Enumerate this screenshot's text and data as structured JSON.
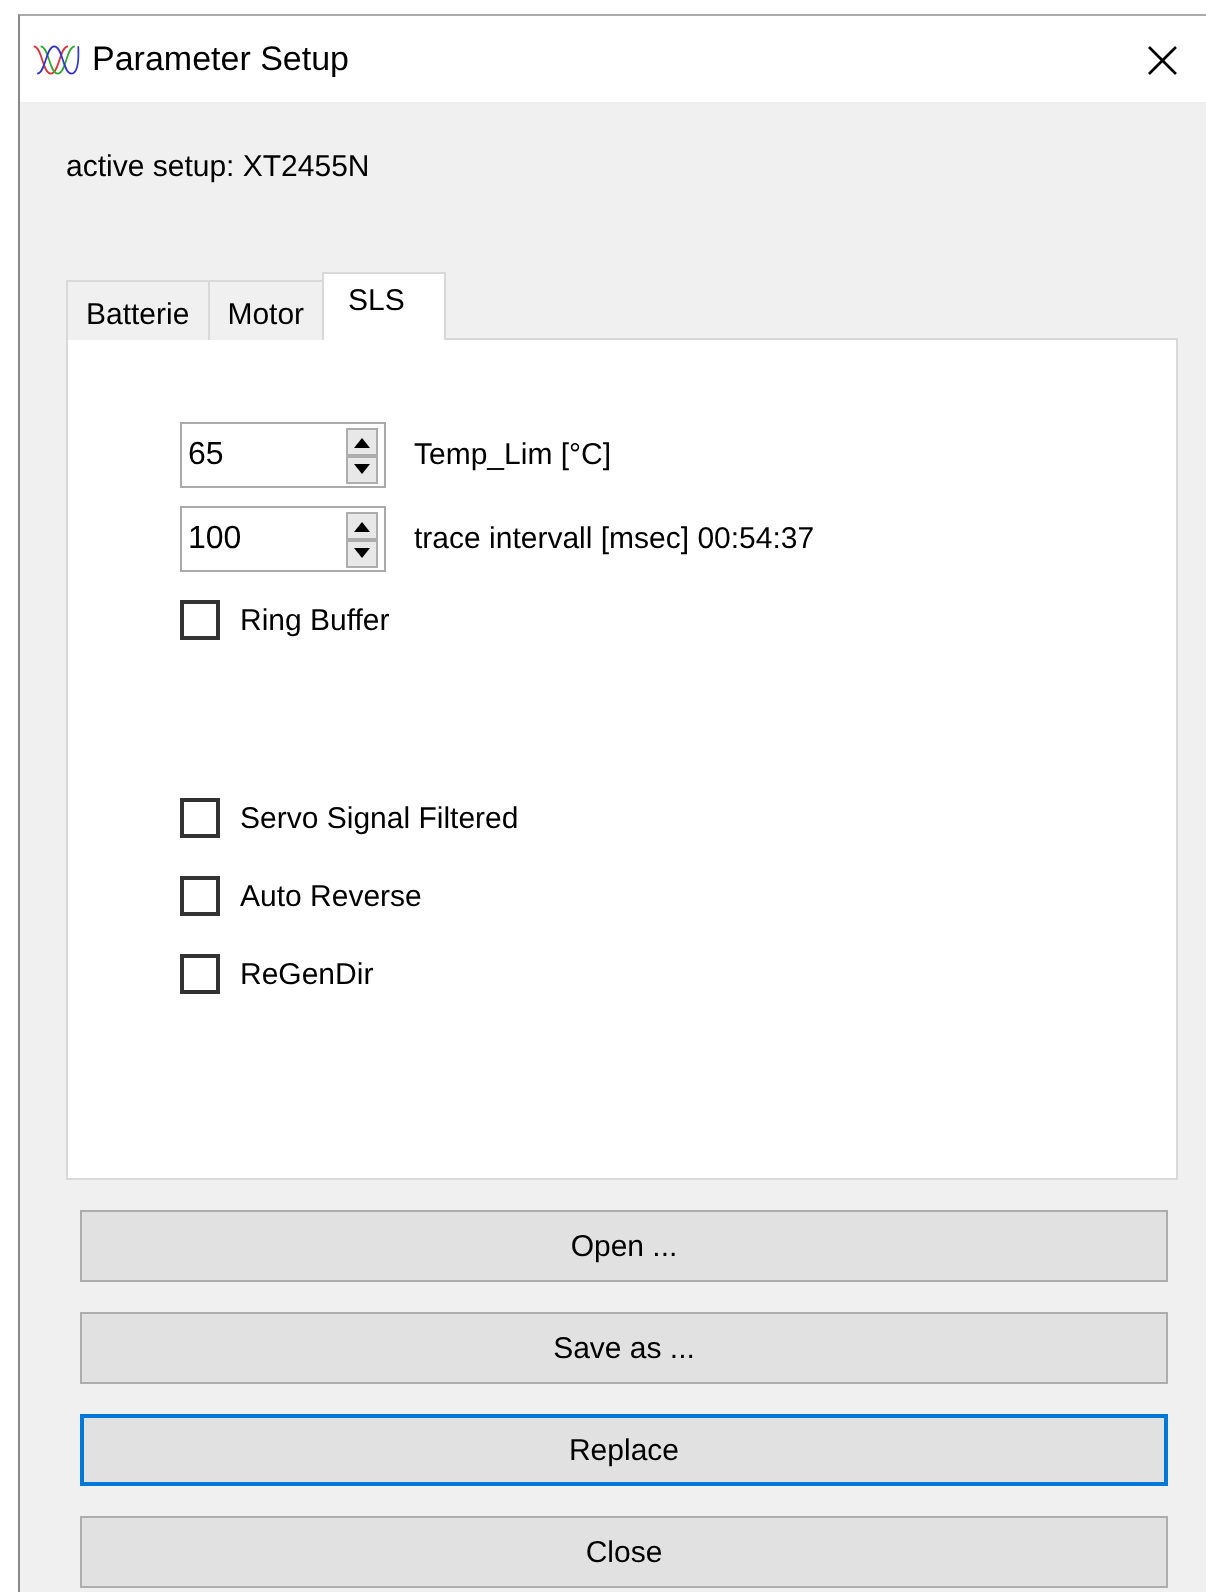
{
  "window": {
    "title": "Parameter Setup",
    "close": "×"
  },
  "active_setup": "active setup: XT2455N",
  "tabs": [
    {
      "label": "Batterie",
      "selected": false
    },
    {
      "label": "Motor",
      "selected": false
    },
    {
      "label": "SLS",
      "selected": true
    }
  ],
  "spinners": [
    {
      "value": "65",
      "label": "Temp_Lim [°C]"
    },
    {
      "value": "100",
      "label": "trace intervall [msec] 00:54:37"
    }
  ],
  "checkbox_groups": [
    [
      {
        "label": "Ring Buffer",
        "checked": false
      }
    ],
    [
      {
        "label": "Servo Signal Filtered",
        "checked": false
      },
      {
        "label": "Auto Reverse",
        "checked": false
      },
      {
        "label": "ReGenDir",
        "checked": false
      }
    ]
  ],
  "buttons": [
    {
      "label": "Open ...",
      "focused": false
    },
    {
      "label": "Save as ...",
      "focused": false
    },
    {
      "label": "Replace",
      "focused": true
    },
    {
      "label": "Close",
      "focused": false
    }
  ]
}
